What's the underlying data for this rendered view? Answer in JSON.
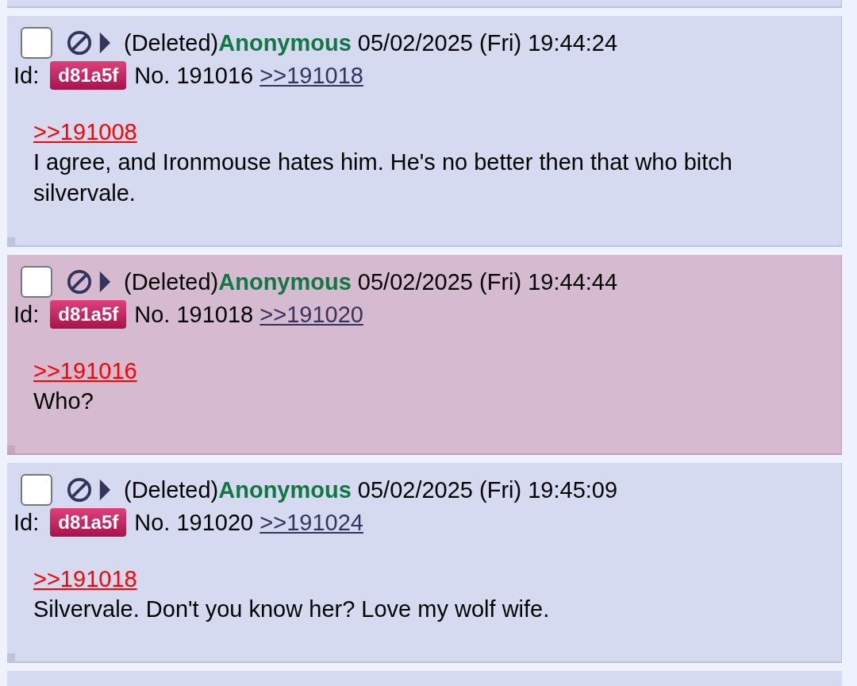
{
  "posts": [
    {
      "checked": false,
      "highlighted": false,
      "status": "(Deleted)",
      "name": "Anonymous",
      "date": "05/02/2025 (Fri) 19:44:24",
      "id_label": "Id:",
      "id": "d81a5f",
      "number": "No. 191016",
      "replies": [
        ">>191018"
      ],
      "quote": ">>191008",
      "body": "I agree, and Ironmouse hates him. He's no better then that who bitch silvervale."
    },
    {
      "checked": false,
      "highlighted": true,
      "status": "(Deleted)",
      "name": "Anonymous",
      "date": "05/02/2025 (Fri) 19:44:44",
      "id_label": "Id:",
      "id": "d81a5f",
      "number": "No. 191018",
      "replies": [
        ">>191020"
      ],
      "quote": ">>191016",
      "body": "Who?"
    },
    {
      "checked": false,
      "highlighted": false,
      "status": "(Deleted)",
      "name": "Anonymous",
      "date": "05/02/2025 (Fri) 19:45:09",
      "id_label": "Id:",
      "id": "d81a5f",
      "number": "No. 191020",
      "replies": [
        ">>191024"
      ],
      "quote": ">>191018",
      "body": "Silvervale. Don't you know her? Love my wolf wife."
    }
  ]
}
